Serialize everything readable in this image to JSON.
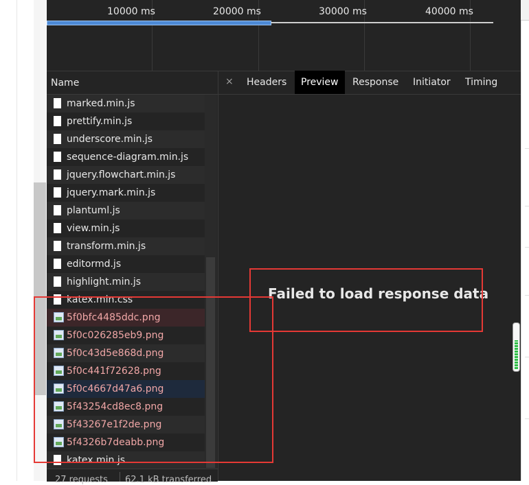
{
  "timeline": {
    "ticks": [
      "10000 ms",
      "20000 ms",
      "30000 ms",
      "40000 ms"
    ],
    "colors": {
      "bar_fill": "#4d8ad6"
    }
  },
  "network": {
    "name_header": "Name",
    "files": [
      {
        "name": "marked.min.js",
        "kind": "script",
        "icon": "file-icon"
      },
      {
        "name": "prettify.min.js",
        "kind": "script",
        "icon": "file-icon"
      },
      {
        "name": "underscore.min.js",
        "kind": "script",
        "icon": "file-icon"
      },
      {
        "name": "sequence-diagram.min.js",
        "kind": "script",
        "icon": "file-icon"
      },
      {
        "name": "jquery.flowchart.min.js",
        "kind": "script",
        "icon": "file-icon"
      },
      {
        "name": "jquery.mark.min.js",
        "kind": "script",
        "icon": "file-icon"
      },
      {
        "name": "plantuml.js",
        "kind": "script",
        "icon": "file-icon"
      },
      {
        "name": "view.min.js",
        "kind": "script",
        "icon": "file-icon"
      },
      {
        "name": "transform.min.js",
        "kind": "script",
        "icon": "file-icon"
      },
      {
        "name": "editormd.js",
        "kind": "script",
        "icon": "file-icon"
      },
      {
        "name": "highlight.min.js",
        "kind": "script",
        "icon": "file-icon"
      },
      {
        "name": "katex.min.css",
        "kind": "stylesheet",
        "icon": "file-icon"
      },
      {
        "name": "5f0bfc4485ddc.png",
        "kind": "image",
        "icon": "image-icon",
        "failed": true
      },
      {
        "name": "5f0c026285eb9.png",
        "kind": "image",
        "icon": "image-icon",
        "failed": true
      },
      {
        "name": "5f0c43d5e868d.png",
        "kind": "image",
        "icon": "image-icon",
        "failed": true
      },
      {
        "name": "5f0c441f72628.png",
        "kind": "image",
        "icon": "image-icon",
        "failed": true
      },
      {
        "name": "5f0c4667d47a6.png",
        "kind": "image",
        "icon": "image-icon",
        "failed": true
      },
      {
        "name": "5f43254cd8ec8.png",
        "kind": "image",
        "icon": "image-icon",
        "failed": true
      },
      {
        "name": "5f43267e1f2de.png",
        "kind": "image",
        "icon": "image-icon",
        "failed": true
      },
      {
        "name": "5f4326b7deabb.png",
        "kind": "image",
        "icon": "image-icon",
        "failed": true
      },
      {
        "name": "katex.min.js",
        "kind": "script",
        "icon": "file-icon"
      }
    ],
    "status": {
      "requests": "27 requests",
      "transferred": "62.1 kB transferred"
    }
  },
  "details": {
    "close_icon": "close-icon",
    "close_glyph": "×",
    "tabs": [
      {
        "label": "Headers",
        "active": false
      },
      {
        "label": "Preview",
        "active": true
      },
      {
        "label": "Response",
        "active": false
      },
      {
        "label": "Initiator",
        "active": false
      },
      {
        "label": "Timing",
        "active": false
      }
    ],
    "preview_message": "Failed to load response data"
  },
  "colors": {
    "panel_bg": "#242424",
    "annotation_red": "#e53935",
    "error_text": "#f1a7a7",
    "active_tab_bg": "#000000"
  }
}
